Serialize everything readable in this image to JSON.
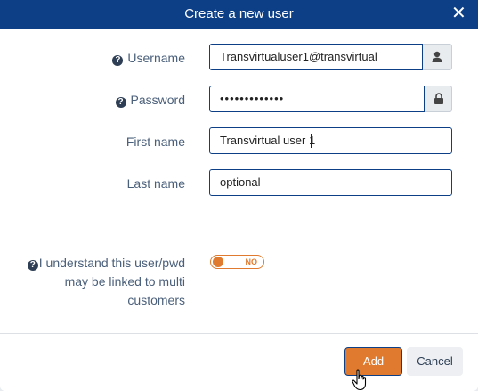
{
  "dialog": {
    "title": "Create a new user",
    "close_icon": "close-icon"
  },
  "form": {
    "username": {
      "label": "Username",
      "value": "Transvirtualuser1@transvirtual",
      "addon_icon": "user-icon"
    },
    "password": {
      "label": "Password",
      "value": "•••••••••••••",
      "addon_icon": "lock-icon"
    },
    "first_name": {
      "label": "First name",
      "value": "Transvirtual user 1"
    },
    "last_name": {
      "label": "Last name",
      "value": "optional"
    },
    "consent": {
      "label": "I understand this user/pwd may be linked to multi customers",
      "toggle_text": "NO",
      "toggle_state": false
    }
  },
  "footer": {
    "add_label": "Add",
    "cancel_label": "Cancel"
  },
  "colors": {
    "header": "#0d3f86",
    "accent": "#e07a2e",
    "label": "#4a5f7a"
  }
}
